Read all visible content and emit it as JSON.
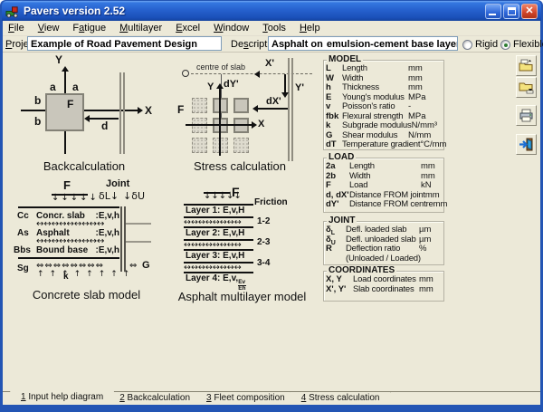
{
  "colors": {
    "titlebar_blue": "#2661ce",
    "window_border": "#2355b4",
    "client_bg": "#ece9d8",
    "slab_fill": "#c9c6bb",
    "textbox_border": "#7f9db9",
    "radio_dot_green": "#2e7d32"
  },
  "window": {
    "title": "Pavers version 2.52"
  },
  "menu": {
    "items": [
      {
        "pre": "",
        "accel": "F",
        "post": "ile"
      },
      {
        "pre": "",
        "accel": "V",
        "post": "iew"
      },
      {
        "pre": "F",
        "accel": "a",
        "post": "tigue"
      },
      {
        "pre": "",
        "accel": "M",
        "post": "ultilayer"
      },
      {
        "pre": "",
        "accel": "E",
        "post": "xcel"
      },
      {
        "pre": "",
        "accel": "W",
        "post": "indow"
      },
      {
        "pre": "",
        "accel": "T",
        "post": "ools"
      },
      {
        "pre": "",
        "accel": "H",
        "post": "elp"
      }
    ]
  },
  "form": {
    "project": {
      "label": {
        "pre": "",
        "accel": "P",
        "post": "roject"
      },
      "value": "Example of Road Pavement Design"
    },
    "description": {
      "label": {
        "pre": "De",
        "accel": "s",
        "post": "cription"
      },
      "value_before_caret": "Asphalt on",
      "value_after_caret": " emulsion-cement base layer"
    },
    "mode": {
      "options": [
        "Rigid",
        "Flexible"
      ],
      "selected": "Flexible"
    }
  },
  "diagrams": {
    "backcalculation": {
      "caption": "Backcalculation",
      "x_axis": "X",
      "y_axis": "Y",
      "a": "a",
      "b": "b",
      "force": "F",
      "distance": "d"
    },
    "stress": {
      "caption": "Stress calculation",
      "centre_label": "centre of slab",
      "x_axis": "X",
      "y_axis": "Y",
      "x_slab": "X'",
      "y_slab": "Y'",
      "dx": "dX'",
      "dy": "dY'",
      "force": "F"
    },
    "concrete": {
      "caption": "Concrete slab model",
      "force": "F",
      "joint_label": "Joint",
      "defl_left": "δL↓",
      "defl_right": "↓δU",
      "layers": [
        {
          "sym": "Cc",
          "name": "Concr. slab",
          "props": ":E,v,h"
        },
        {
          "sym": "As",
          "name": "Asphalt",
          "props": ":E,v,h"
        },
        {
          "sym": "Bbs",
          "name": "Bound base",
          "props": ":E,v,h"
        }
      ],
      "subgrade_sym": "Sg",
      "k": "k",
      "g": "G",
      "load_arrows": "↓↓↓↓↓",
      "iface_arrows": "↔↔↔↔↔↔↔↔↔",
      "spring_arrows": "⇔⇔⇔⇔⇔⇔⇔⇔",
      "g_spring": "⇔",
      "up_arrows": "↑↑↑↑↑↑↑↑"
    },
    "asphalt": {
      "caption": "Asphalt multilayer model",
      "force": "F",
      "friction_label": "Friction",
      "layers": [
        {
          "name": "Layer 1: E,v,H",
          "iface": "1-2"
        },
        {
          "name": "Layer 2: E,v,H",
          "iface": "2-3"
        },
        {
          "name": "Layer 3: E,v,H",
          "iface": "3-4"
        },
        {
          "name": "Layer 4: E,v,",
          "frac_top": "Ev",
          "frac_bottom": "Eh"
        }
      ],
      "load_arrows": "↓↓↓↓↓",
      "iface_arrows": "↔↔↔↔↔↔↔↔"
    }
  },
  "panels": [
    {
      "title": "MODEL",
      "rows": [
        {
          "sym": "L",
          "desc": "Length",
          "unit": "mm"
        },
        {
          "sym": "W",
          "desc": "Width",
          "unit": "mm"
        },
        {
          "sym": "h",
          "desc": "Thickness",
          "unit": "mm"
        },
        {
          "sym": "E",
          "desc": "Young's modulus",
          "unit": "MPa"
        },
        {
          "sym": "v",
          "desc": "Poisson's ratio",
          "unit": "-"
        },
        {
          "sym": "fbk",
          "desc": "Flexural strength",
          "unit": "MPa"
        },
        {
          "sym": "k",
          "desc": "Subgrade modulus",
          "unit": "N/mm³"
        },
        {
          "sym": "G",
          "desc": "Shear modulus",
          "unit": "N/mm"
        },
        {
          "sym": "dT",
          "desc": "Temperature gradient",
          "unit": "°C/mm"
        }
      ]
    },
    {
      "title": "LOAD",
      "rows": [
        {
          "sym": "2a",
          "desc": "Length",
          "unit": "mm"
        },
        {
          "sym": "2b",
          "desc": "Width",
          "unit": "mm"
        },
        {
          "sym": "F",
          "desc": "Load",
          "unit": "kN"
        },
        {
          "sym": "d, dX'",
          "desc": "Distance FROM joint",
          "unit": "mm"
        },
        {
          "sym": "dY'",
          "desc": "Distance FROM centre",
          "unit": "mm"
        }
      ]
    },
    {
      "title": "JOINT",
      "rows": [
        {
          "sym": "δ",
          "sub": "L",
          "desc": "Defl. loaded slab",
          "unit": "µm"
        },
        {
          "sym": "δ",
          "sub": "U",
          "desc": "Defl. unloaded slab",
          "unit": "µm"
        },
        {
          "sym": "R",
          "sub": "",
          "desc": "Deflection ratio",
          "unit": "%"
        },
        {
          "sym": "",
          "sub": "",
          "desc": "(Unloaded / Loaded)",
          "unit": ""
        }
      ]
    },
    {
      "title": "COORDINATES",
      "rows": [
        {
          "sym": "X, Y",
          "desc": "Load coordinates",
          "unit": "mm"
        },
        {
          "sym": "X', Y'",
          "desc": "Slab coordinates",
          "unit": "mm"
        }
      ]
    }
  ],
  "side_toolbar": [
    {
      "name": "open"
    },
    {
      "name": "save"
    },
    {
      "name": "print"
    },
    {
      "name": "exit"
    }
  ],
  "tabs": [
    {
      "accel": "1",
      "post": " Input help diagram",
      "active": true
    },
    {
      "accel": "2",
      "post": " Backcalculation",
      "active": false
    },
    {
      "accel": "3",
      "post": " Fleet composition",
      "active": false
    },
    {
      "accel": "4",
      "post": " Stress calculation",
      "active": false
    }
  ]
}
